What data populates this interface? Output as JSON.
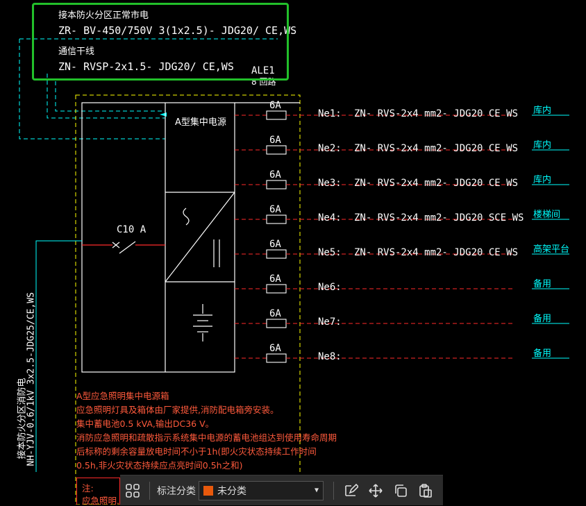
{
  "header": {
    "feeder_label": "接本防火分区正常市电",
    "feeder_cable": "ZR- BV-450/750V 3(1x2.5)- JDG20/ CE,WS",
    "comm_label": "通信干线",
    "comm_cable": "ZN- RVSP-2x1.5- JDG20/ CE,WS"
  },
  "panel": {
    "id": "ALE1",
    "circuits": "8 回路",
    "main_title": "A型集中电源",
    "breaker": "C10 A"
  },
  "incoming": {
    "label": "接本防火分区消防电",
    "cable": "NH-YJV-0.6/1kV 3x2.5-JDG25/CE,WS"
  },
  "circuits": [
    {
      "fuse": "6A",
      "name": "Ne1:",
      "cable": "ZN- RVS-2x4 mm2- JDG20  CE  WS",
      "dest": "库内"
    },
    {
      "fuse": "6A",
      "name": "Ne2:",
      "cable": "ZN- RVS-2x4 mm2- JDG20  CE  WS",
      "dest": "库内"
    },
    {
      "fuse": "6A",
      "name": "Ne3:",
      "cable": "ZN- RVS-2x4 mm2- JDG20  CE  WS",
      "dest": "库内"
    },
    {
      "fuse": "6A",
      "name": "Ne4:",
      "cable": "ZN- RVS-2x4 mm2- JDG20  SCE  WS",
      "dest": "楼梯间"
    },
    {
      "fuse": "6A",
      "name": "Ne5:",
      "cable": "ZN- RVS-2x4 mm2- JDG20  CE  WS",
      "dest": "高架平台"
    },
    {
      "fuse": "6A",
      "name": "Ne6:",
      "cable": "",
      "dest": "备用"
    },
    {
      "fuse": "6A",
      "name": "Ne7:",
      "cable": "",
      "dest": "备用"
    },
    {
      "fuse": "6A",
      "name": "Ne8:",
      "cable": "",
      "dest": "备用"
    }
  ],
  "notes": [
    "A型应急照明集中电源箱",
    "应急照明灯具及箱体由厂家提供,消防配电箱旁安装。",
    "集中蓄电池0.5 kVA,输出DC36 V。",
    "消防应急照明和疏散指示系统集中电源的蓄电池组达到使用寿命周期",
    "后标称的剩余容量放电时间不小于1h(即火灾状态持续工作时间",
    "0.5h,非火灾状态持续应点亮时间0.5h之和)"
  ],
  "note_header": "注:",
  "note_cut": "应急照明...",
  "toolbar": {
    "category_label": "标注分类",
    "selected": "未分类",
    "swatch_color": "#e8590c"
  },
  "colors": {
    "highlight": "#22c02a",
    "panel_outline": "#ffffff",
    "dashed_yellow": "#ffff00",
    "cyan": "#00ffff",
    "red": "#ff2a2a"
  }
}
